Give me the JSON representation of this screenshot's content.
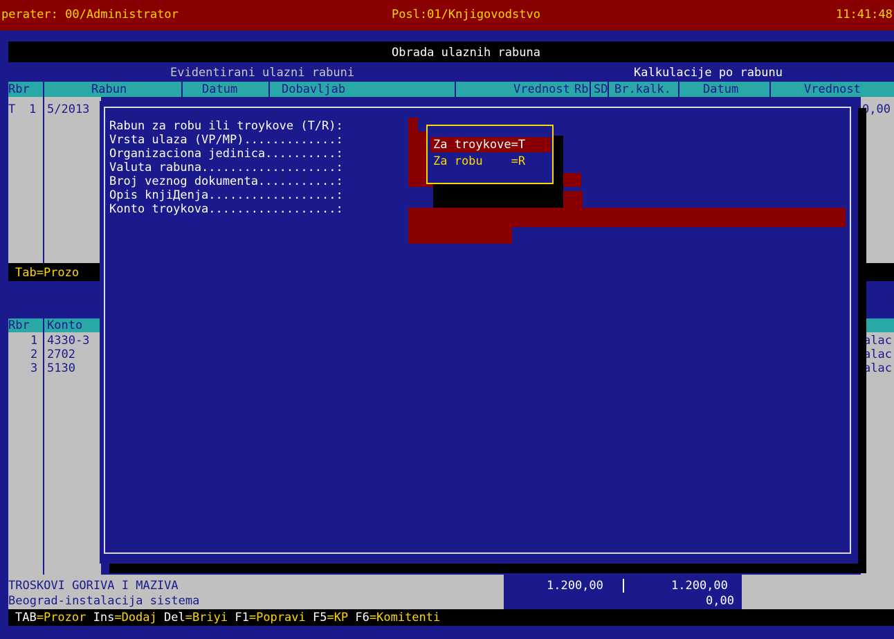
{
  "status_bar": {
    "operator": "perater: 00/Administrator",
    "position": "Posl:01/Knjigovodstvo",
    "time": "11:41:48"
  },
  "main_title": "Obrada ulaznih rabuna",
  "left_panel": {
    "title": "Evidentirani ulazni rabuni",
    "headers": {
      "rbr": "Rbr",
      "racun": "Rabun",
      "datum": "Datum",
      "dobavljac": "Dobavljab",
      "vrednost": "Vrednost"
    },
    "row1": {
      "type": "T",
      "rbr": "1",
      "racun": "5/2013"
    },
    "tab_hint": "Tab=Prozo"
  },
  "right_panel": {
    "title": "Kalkulacije po rabunu",
    "headers": {
      "rb": "Rb",
      "sd": "SD",
      "brkalk": "Br.kalk.",
      "datum": "Datum",
      "vrednost": "Vrednost"
    },
    "row1_value": "0,00"
  },
  "stavke": {
    "headers": {
      "rbr": "Rbr",
      "konto": "Konto"
    },
    "rows": [
      {
        "rbr": "1",
        "konto": "4330-3",
        "tail": "alac"
      },
      {
        "rbr": "2",
        "konto": "2702",
        "tail": "alac"
      },
      {
        "rbr": "3",
        "konto": "5130",
        "tail": "alac"
      }
    ]
  },
  "form": {
    "fields": [
      "Rabun za robu ili troykove (T/R):",
      "Vrsta ulaza (VP/MP).............:",
      "Organizaciona jedinica..........:",
      "Valuta rabuna...................:",
      "Broj veznog dokumenta...........:",
      "Opis knjiДenja..................:",
      "Konto troykova..................:"
    ]
  },
  "popup": {
    "options": [
      {
        "label": "Za troykove=T"
      },
      {
        "label": "Za robu    =R"
      }
    ]
  },
  "bottom": {
    "line1": "TROSKOVI GORIVA I MAZIVA",
    "line2": "Beograd-instalacija sistema",
    "value1": "1.200,00",
    "value2": "1.200,00",
    "value3": "0,00"
  },
  "hotkeys": {
    "tab": "TAB",
    "tab_label": "=Prozor ",
    "ins": "Ins",
    "ins_label": "=Dodaj ",
    "del": "Del",
    "del_label": "=Briyi ",
    "f1": "F1",
    "f1_label": "=Popravi ",
    "f5": "F5",
    "f5_label": "=KP ",
    "f6": "F6",
    "f6_label": "=Komitenti"
  }
}
